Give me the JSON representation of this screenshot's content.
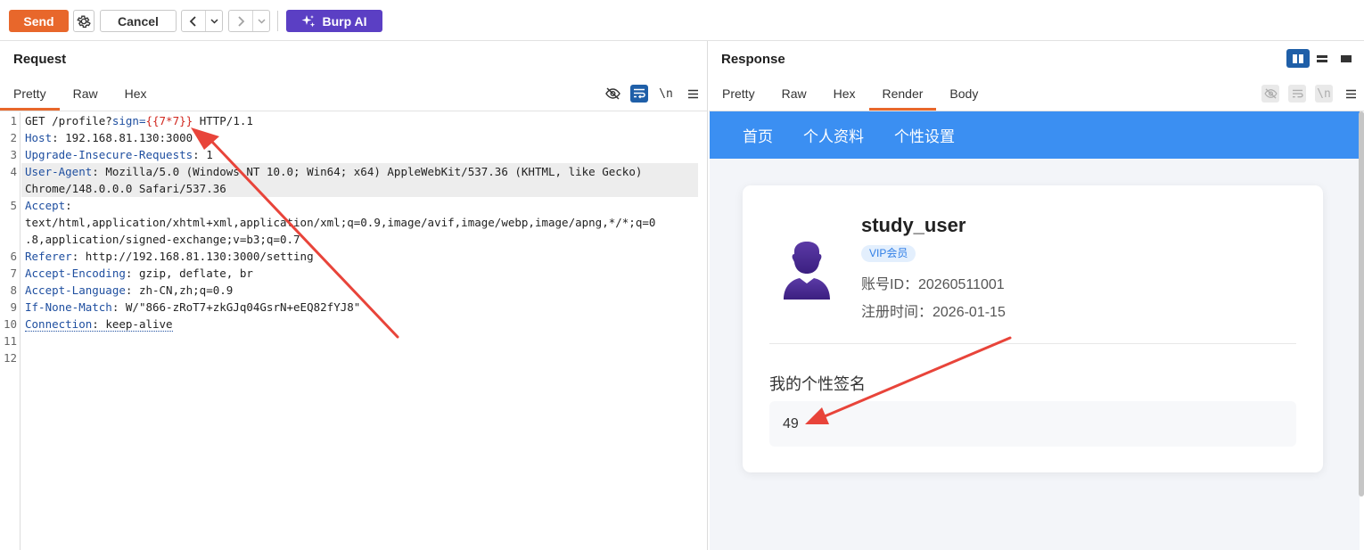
{
  "toolbar": {
    "send_label": "Send",
    "cancel_label": "Cancel",
    "burp_ai_label": "Burp AI"
  },
  "request": {
    "title": "Request",
    "tabs": [
      {
        "label": "Pretty"
      },
      {
        "label": "Raw"
      },
      {
        "label": "Hex"
      }
    ],
    "newline_label": "\\n",
    "line_numbers": [
      "1",
      "2",
      "3",
      "4",
      "",
      "5",
      "",
      "",
      "6",
      "7",
      "8",
      "9",
      "10",
      "11",
      "12"
    ],
    "lines": {
      "l1_method": "GET /profile?",
      "l1_param": "sign",
      "l1_eq": "=",
      "l1_value": "{{7*7}}",
      "l1_proto": " HTTP/1.1",
      "l2_name": "Host",
      "l2_value": ": 192.168.81.130:3000",
      "l3_name": "Upgrade-Insecure-Requests",
      "l3_value": ": 1",
      "l4_name": "User-Agent",
      "l4_value": ": Mozilla/5.0 (Windows NT 10.0; Win64; x64) AppleWebKit/537.36 (KHTML, like Gecko)",
      "l4_wrap": "Chrome/148.0.0.0 Safari/537.36",
      "l5_name": "Accept",
      "l5_value": ":",
      "l5_wrap1": "text/html,application/xhtml+xml,application/xml;q=0.9,image/avif,image/webp,image/apng,*/*;q=0",
      "l5_wrap2": ".8,application/signed-exchange;v=b3;q=0.7",
      "l6_name": "Referer",
      "l6_value": ": http://192.168.81.130:3000/setting",
      "l7_name": "Accept-Encoding",
      "l7_value": ": gzip, deflate, br",
      "l8_name": "Accept-Language",
      "l8_value": ": zh-CN,zh;q=0.9",
      "l9_name": "If-None-Match",
      "l9_value": ": W/\"866-zRoT7+zkGJq04GsrN+eEQ82fYJ8\"",
      "l10_name": "Connection",
      "l10_value": ": keep-alive"
    }
  },
  "response": {
    "title": "Response",
    "tabs": [
      {
        "label": "Pretty"
      },
      {
        "label": "Raw"
      },
      {
        "label": "Hex"
      },
      {
        "label": "Render"
      },
      {
        "label": "Body"
      }
    ],
    "newline_label": "\\n",
    "render": {
      "nav": [
        "首页",
        "个人资料",
        "个性设置"
      ],
      "username": "study_user",
      "badge": "VIP会员",
      "account_id": "账号ID：20260511001",
      "register_time": "注册时间：2026-01-15",
      "signature_title": "我的个性签名",
      "signature_value": "49"
    }
  },
  "colors": {
    "accent": "#e8672b",
    "burp_ai": "#5b3fc4",
    "nav_blue": "#3b8ff2",
    "arrow": "#e8443a"
  }
}
